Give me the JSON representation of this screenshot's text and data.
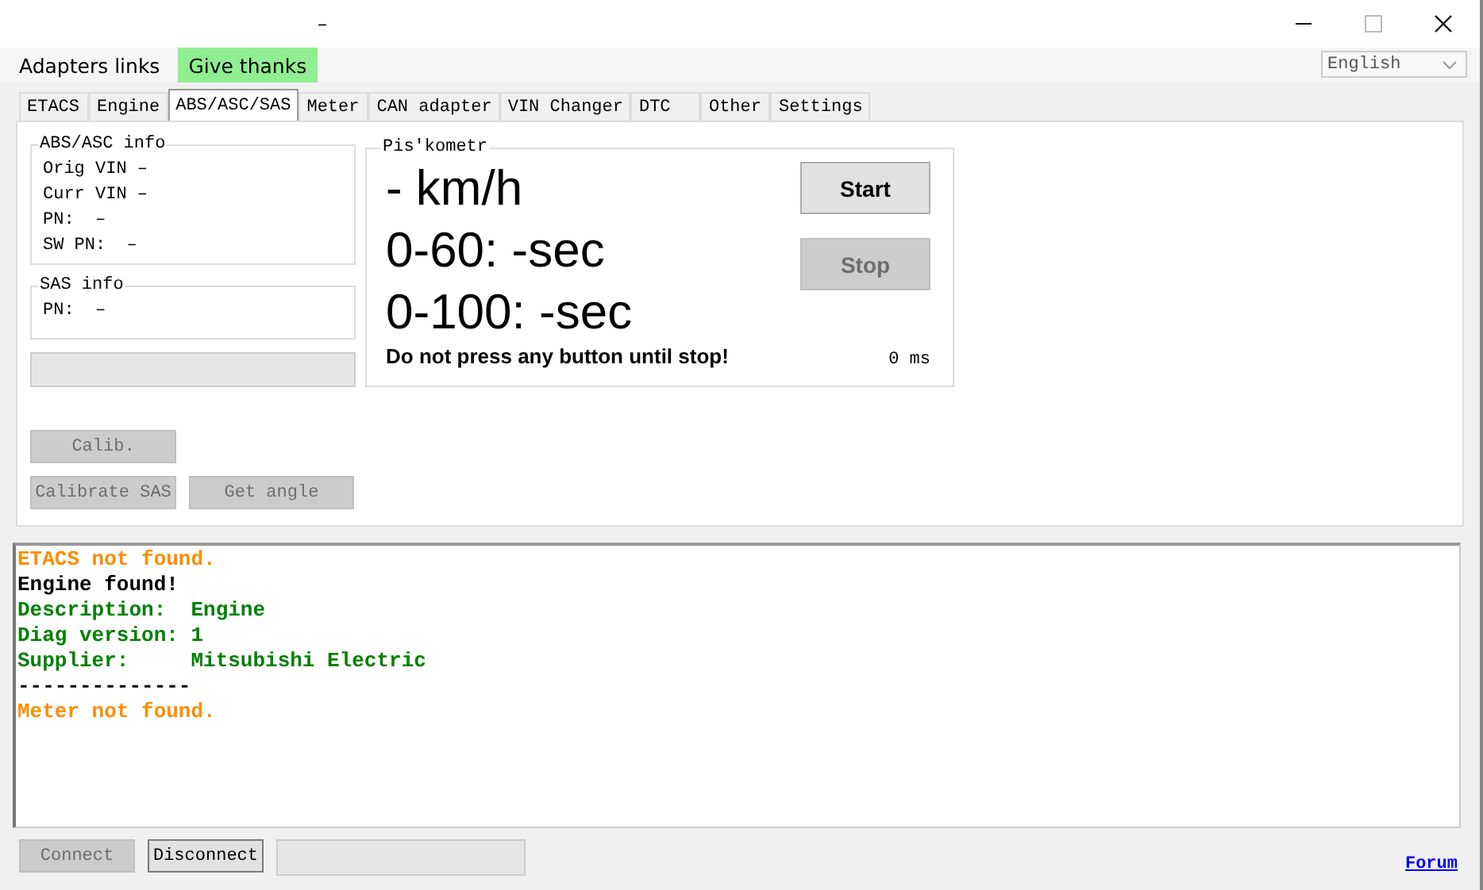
{
  "window": {
    "title": "–"
  },
  "menu": [
    {
      "label": "Adapters links",
      "kind": "plain"
    },
    {
      "label": "Give thanks",
      "kind": "highlight"
    }
  ],
  "language": {
    "value": "English"
  },
  "tabs": [
    {
      "label": "ETACS",
      "selected": false
    },
    {
      "label": "Engine",
      "selected": false
    },
    {
      "label": "ABS/ASC/SAS",
      "selected": true
    },
    {
      "label": "Meter",
      "selected": false
    },
    {
      "label": "CAN adapter",
      "selected": false
    },
    {
      "label": "VIN Changer",
      "selected": false
    },
    {
      "label": "DTC",
      "selected": false
    },
    {
      "label": "Other",
      "selected": false
    },
    {
      "label": "Settings",
      "selected": false
    }
  ],
  "abs_info": {
    "title": "ABS/ASC info",
    "lines": [
      "Orig VIN –",
      "Curr VIN –",
      "PN:  –",
      "SW PN:  –"
    ]
  },
  "sas_info": {
    "title": "SAS info",
    "lines": [
      "PN:  –"
    ]
  },
  "left_buttons": [
    {
      "label": "Calib.",
      "disabled": true
    },
    {
      "label": "Calibrate SAS",
      "disabled": true
    },
    {
      "label": "Get angle",
      "disabled": true
    }
  ],
  "speedometer": {
    "title": "Pis'kometr",
    "speed": "- km/h",
    "t60": "0-60: -sec",
    "t100": "0-100: -sec",
    "warning": "Do not press any button until stop!",
    "elapsed": "0 ms",
    "buttons": [
      {
        "label": "Start",
        "disabled": false
      },
      {
        "label": "Stop",
        "disabled": true
      }
    ]
  },
  "log": [
    {
      "text": "ETACS not found.",
      "color": "#ff8c00"
    },
    {
      "text": "Engine found!",
      "color": "#000000"
    },
    {
      "text": "Description:  Engine",
      "color": "#008000"
    },
    {
      "text": "Diag version: 1",
      "color": "#008000"
    },
    {
      "text": "Supplier:     Mitsubishi Electric",
      "color": "#008000"
    },
    {
      "text": "--------------",
      "color": "#000000"
    },
    {
      "text": "Meter not found.",
      "color": "#ff8c00"
    }
  ],
  "bottom_buttons": [
    {
      "label": "Connect",
      "disabled": true
    },
    {
      "label": "Disconnect",
      "disabled": false
    }
  ],
  "forum_link": "Forum"
}
